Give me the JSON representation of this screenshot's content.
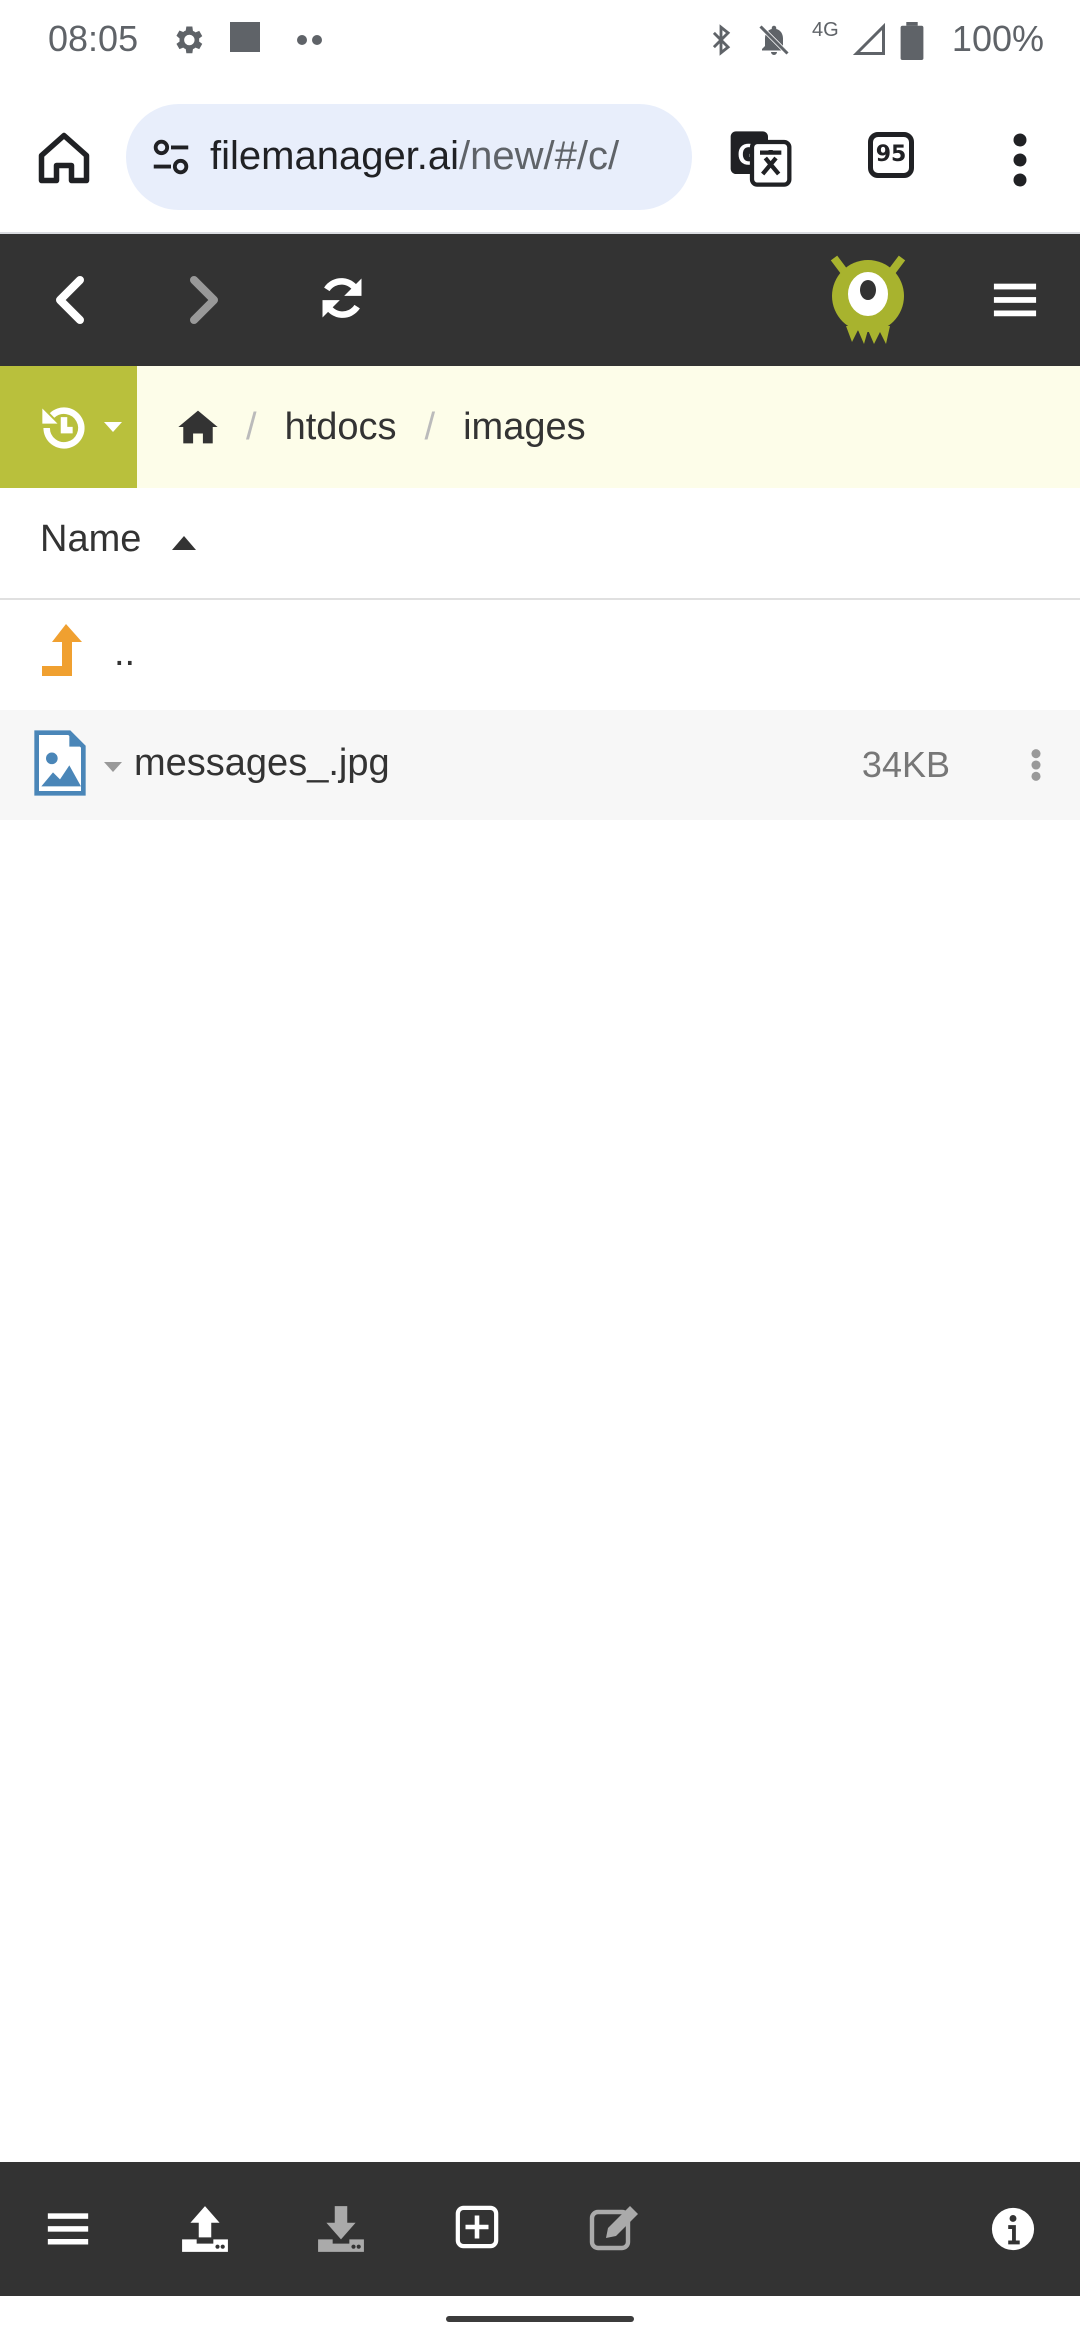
{
  "status_bar": {
    "time": "08:05",
    "battery": "100%",
    "network": "4G"
  },
  "browser": {
    "url_host": "filemanager.ai",
    "url_rest": "/new/#/c/",
    "tab_count": "95"
  },
  "breadcrumb": {
    "items": [
      "htdocs",
      "images"
    ],
    "separator": "/"
  },
  "file_list": {
    "column_name": "Name",
    "parent_label": "..",
    "files": [
      {
        "name": "messages_.jpg",
        "size": "34KB"
      }
    ]
  },
  "colors": {
    "app_bar": "#333333",
    "accent": "#b9c03c",
    "breadcrumb_bg": "#fdfde9",
    "up_arrow": "#f0a030",
    "file_icon": "#4a86b8"
  }
}
